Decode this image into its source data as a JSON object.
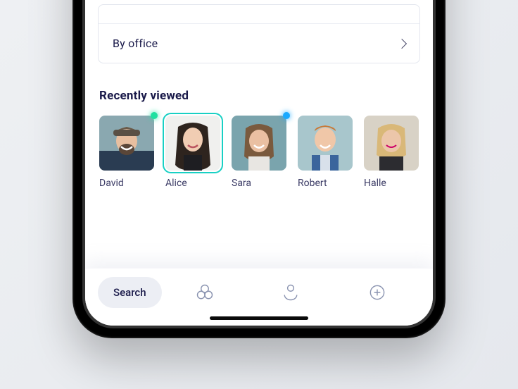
{
  "filters": {
    "by_office": {
      "label": "By office"
    }
  },
  "recently_viewed": {
    "title": "Recently viewed",
    "people": [
      {
        "name": "David",
        "status": "green",
        "selected": false
      },
      {
        "name": "Alice",
        "status": null,
        "selected": true
      },
      {
        "name": "Sara",
        "status": "blue",
        "selected": false
      },
      {
        "name": "Robert",
        "status": null,
        "selected": false
      },
      {
        "name": "Halle",
        "status": null,
        "selected": false
      }
    ]
  },
  "tabbar": {
    "search_label": "Search",
    "icons": {
      "groups": "groups-icon",
      "profile": "profile-icon",
      "add": "plus-icon"
    }
  },
  "colors": {
    "accent_teal": "#18d0c4",
    "text_primary": "#1a1a4a",
    "status_green": "#1fe0a0",
    "status_blue": "#1aa9ff"
  }
}
